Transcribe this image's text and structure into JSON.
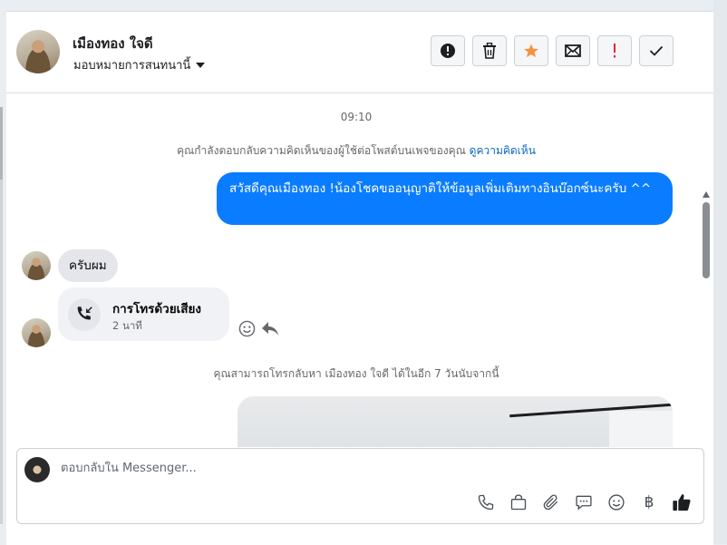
{
  "contact": {
    "name": "เมืองทอง ใจดี",
    "assign_label": "มอบหมายการสนทนานี้"
  },
  "header_actions": [
    {
      "icon": "exclamation-circle-icon"
    },
    {
      "icon": "trash-icon"
    },
    {
      "icon": "star-icon",
      "color": "#f7923b"
    },
    {
      "icon": "envelope-icon"
    },
    {
      "icon": "red-exclamation-icon",
      "color": "#e41e3f"
    },
    {
      "icon": "checkmark-icon"
    }
  ],
  "conversation": {
    "timestamp": "09:10",
    "reply_note_text": "คุณกำลังตอบกลับความคิดเห็นของผู้ใช้ต่อโพสต์บนเพจของคุณ",
    "reply_note_link": "ดูความคิดเห็น",
    "outgoing_message": "สวัสดีคุณเมืองทอง !น้องโชคขออนุญาติให้ข้อมูลเพิ่มเติมทางอินบ๊อกซ์นะครับ ^^",
    "incoming_message": "ครับผม",
    "call": {
      "title": "การโทรด้วยเสียง",
      "duration": "2 นาที"
    },
    "callback_note": "คุณสามารถโทรกลับหา เมืองทอง ใจดี ได้ในอีก 7 วันนับจากนี้"
  },
  "composer": {
    "placeholder": "ตอบกลับใน Messenger...",
    "currency_symbol": "฿"
  },
  "colors": {
    "outgoing_bubble": "#0a7cff",
    "link": "#0a66c2",
    "like": "#1c1e21"
  }
}
